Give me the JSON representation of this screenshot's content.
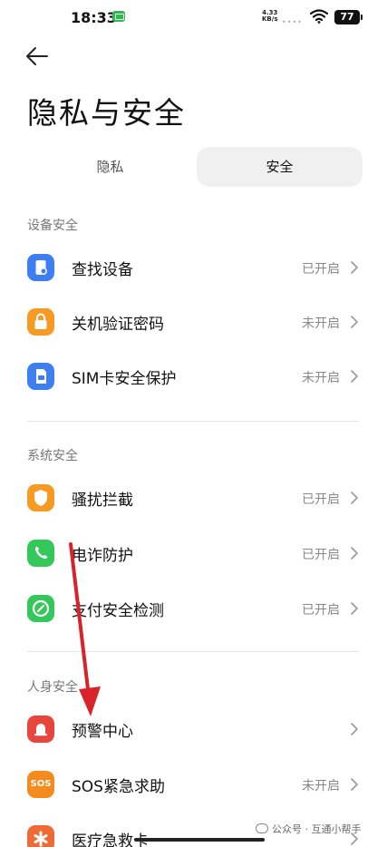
{
  "status_bar": {
    "time": "18:33",
    "net_speed_value": "4.33",
    "net_speed_unit": "KB/s",
    "battery": "77"
  },
  "header": {
    "title": "隐私与安全"
  },
  "tabs": [
    {
      "label": "隐私",
      "selected": false
    },
    {
      "label": "安全",
      "selected": true
    }
  ],
  "sections": {
    "device": {
      "title": "设备安全",
      "items": [
        {
          "label": "查找设备",
          "status": "已开启",
          "icon": "find-device-icon",
          "color": "#3d7ef2"
        },
        {
          "label": "关机验证密码",
          "status": "未开启",
          "icon": "lock-icon",
          "color": "#f59a23"
        },
        {
          "label": "SIM卡安全保护",
          "status": "未开启",
          "icon": "sim-card-icon",
          "color": "#3d7ef2"
        }
      ]
    },
    "system": {
      "title": "系统安全",
      "items": [
        {
          "label": "骚扰拦截",
          "status": "已开启",
          "icon": "shield-icon",
          "color": "#f59a23"
        },
        {
          "label": "电诈防护",
          "status": "已开启",
          "icon": "phone-icon",
          "color": "#34c759"
        },
        {
          "label": "支付安全检测",
          "status": "已开启",
          "icon": "payment-check-icon",
          "color": "#34c759"
        }
      ]
    },
    "personal": {
      "title": "人身安全",
      "items": [
        {
          "label": "预警中心",
          "status": "",
          "icon": "bell-icon",
          "color": "#e8453c"
        },
        {
          "label": "SOS紧急求助",
          "status": "未开启",
          "icon": "sos-icon",
          "icon_text": "SOS",
          "color": "#f58a1f"
        },
        {
          "label": "医疗急救卡",
          "status": "",
          "icon": "medical-icon",
          "color": "#f06a35"
        }
      ]
    }
  },
  "watermark": "公众号 · 互通小帮手"
}
